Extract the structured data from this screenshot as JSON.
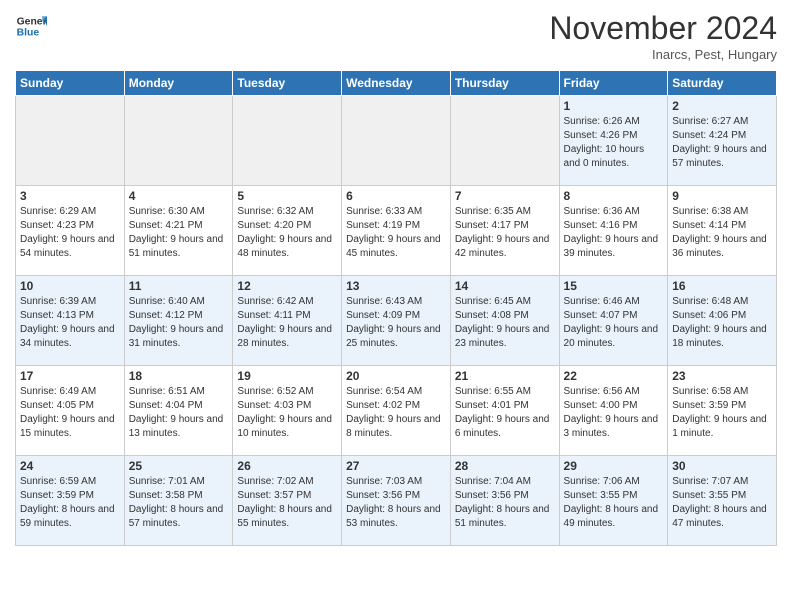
{
  "header": {
    "logo_line1": "General",
    "logo_line2": "Blue",
    "month": "November 2024",
    "location": "Inarcs, Pest, Hungary"
  },
  "weekdays": [
    "Sunday",
    "Monday",
    "Tuesday",
    "Wednesday",
    "Thursday",
    "Friday",
    "Saturday"
  ],
  "weeks": [
    [
      {
        "day": "",
        "empty": true
      },
      {
        "day": "",
        "empty": true
      },
      {
        "day": "",
        "empty": true
      },
      {
        "day": "",
        "empty": true
      },
      {
        "day": "",
        "empty": true
      },
      {
        "day": "1",
        "sunrise": "6:26 AM",
        "sunset": "4:26 PM",
        "daylight": "10 hours and 0 minutes."
      },
      {
        "day": "2",
        "sunrise": "6:27 AM",
        "sunset": "4:24 PM",
        "daylight": "9 hours and 57 minutes."
      }
    ],
    [
      {
        "day": "3",
        "sunrise": "6:29 AM",
        "sunset": "4:23 PM",
        "daylight": "9 hours and 54 minutes."
      },
      {
        "day": "4",
        "sunrise": "6:30 AM",
        "sunset": "4:21 PM",
        "daylight": "9 hours and 51 minutes."
      },
      {
        "day": "5",
        "sunrise": "6:32 AM",
        "sunset": "4:20 PM",
        "daylight": "9 hours and 48 minutes."
      },
      {
        "day": "6",
        "sunrise": "6:33 AM",
        "sunset": "4:19 PM",
        "daylight": "9 hours and 45 minutes."
      },
      {
        "day": "7",
        "sunrise": "6:35 AM",
        "sunset": "4:17 PM",
        "daylight": "9 hours and 42 minutes."
      },
      {
        "day": "8",
        "sunrise": "6:36 AM",
        "sunset": "4:16 PM",
        "daylight": "9 hours and 39 minutes."
      },
      {
        "day": "9",
        "sunrise": "6:38 AM",
        "sunset": "4:14 PM",
        "daylight": "9 hours and 36 minutes."
      }
    ],
    [
      {
        "day": "10",
        "sunrise": "6:39 AM",
        "sunset": "4:13 PM",
        "daylight": "9 hours and 34 minutes."
      },
      {
        "day": "11",
        "sunrise": "6:40 AM",
        "sunset": "4:12 PM",
        "daylight": "9 hours and 31 minutes."
      },
      {
        "day": "12",
        "sunrise": "6:42 AM",
        "sunset": "4:11 PM",
        "daylight": "9 hours and 28 minutes."
      },
      {
        "day": "13",
        "sunrise": "6:43 AM",
        "sunset": "4:09 PM",
        "daylight": "9 hours and 25 minutes."
      },
      {
        "day": "14",
        "sunrise": "6:45 AM",
        "sunset": "4:08 PM",
        "daylight": "9 hours and 23 minutes."
      },
      {
        "day": "15",
        "sunrise": "6:46 AM",
        "sunset": "4:07 PM",
        "daylight": "9 hours and 20 minutes."
      },
      {
        "day": "16",
        "sunrise": "6:48 AM",
        "sunset": "4:06 PM",
        "daylight": "9 hours and 18 minutes."
      }
    ],
    [
      {
        "day": "17",
        "sunrise": "6:49 AM",
        "sunset": "4:05 PM",
        "daylight": "9 hours and 15 minutes."
      },
      {
        "day": "18",
        "sunrise": "6:51 AM",
        "sunset": "4:04 PM",
        "daylight": "9 hours and 13 minutes."
      },
      {
        "day": "19",
        "sunrise": "6:52 AM",
        "sunset": "4:03 PM",
        "daylight": "9 hours and 10 minutes."
      },
      {
        "day": "20",
        "sunrise": "6:54 AM",
        "sunset": "4:02 PM",
        "daylight": "9 hours and 8 minutes."
      },
      {
        "day": "21",
        "sunrise": "6:55 AM",
        "sunset": "4:01 PM",
        "daylight": "9 hours and 6 minutes."
      },
      {
        "day": "22",
        "sunrise": "6:56 AM",
        "sunset": "4:00 PM",
        "daylight": "9 hours and 3 minutes."
      },
      {
        "day": "23",
        "sunrise": "6:58 AM",
        "sunset": "3:59 PM",
        "daylight": "9 hours and 1 minute."
      }
    ],
    [
      {
        "day": "24",
        "sunrise": "6:59 AM",
        "sunset": "3:59 PM",
        "daylight": "8 hours and 59 minutes."
      },
      {
        "day": "25",
        "sunrise": "7:01 AM",
        "sunset": "3:58 PM",
        "daylight": "8 hours and 57 minutes."
      },
      {
        "day": "26",
        "sunrise": "7:02 AM",
        "sunset": "3:57 PM",
        "daylight": "8 hours and 55 minutes."
      },
      {
        "day": "27",
        "sunrise": "7:03 AM",
        "sunset": "3:56 PM",
        "daylight": "8 hours and 53 minutes."
      },
      {
        "day": "28",
        "sunrise": "7:04 AM",
        "sunset": "3:56 PM",
        "daylight": "8 hours and 51 minutes."
      },
      {
        "day": "29",
        "sunrise": "7:06 AM",
        "sunset": "3:55 PM",
        "daylight": "8 hours and 49 minutes."
      },
      {
        "day": "30",
        "sunrise": "7:07 AM",
        "sunset": "3:55 PM",
        "daylight": "8 hours and 47 minutes."
      }
    ]
  ]
}
